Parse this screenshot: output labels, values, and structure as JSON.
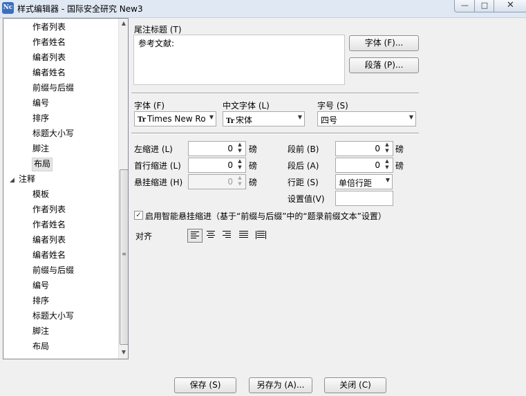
{
  "window": {
    "title": "样式编辑器 - 国际安全研究 New3",
    "icon_text": "Nc",
    "min_glyph": "—",
    "max_glyph": "□",
    "close_glyph": "✕"
  },
  "tree": {
    "group1_items": [
      "作者列表",
      "作者姓名",
      "编者列表",
      "编者姓名",
      "前缀与后缀",
      "编号",
      "排序",
      "标题大小写",
      "脚注",
      "布局"
    ],
    "parent": "注释",
    "group2_items": [
      "模板",
      "作者列表",
      "作者姓名",
      "编者列表",
      "编者姓名",
      "前缀与后缀",
      "编号",
      "排序",
      "标题大小写",
      "脚注",
      "布局"
    ],
    "selected": "布局"
  },
  "footnote": {
    "label": "尾注标题 (T)",
    "value": "参考文献:"
  },
  "buttons": {
    "font": "字体 (F)...",
    "paragraph": "段落 (P)...",
    "save": "保存 (S)",
    "save_as": "另存为 (A)...",
    "close": "关闭 (C)"
  },
  "fonts": {
    "font_label": "字体 (F)",
    "font_value": "Times New Ro",
    "cn_font_label": "中文字体 (L)",
    "cn_font_value": "宋体",
    "size_label": "字号 (S)",
    "size_value": "四号",
    "tt_glyph": "Tr"
  },
  "indent": {
    "left_label": "左缩进 (L)",
    "left_value": "0",
    "first_label": "首行缩进 (L)",
    "first_value": "0",
    "hang_label": "悬挂缩进 (H)",
    "hang_value": "0",
    "unit": "磅"
  },
  "spacing": {
    "before_label": "段前 (B)",
    "before_value": "0",
    "after_label": "段后 (A)",
    "after_value": "0",
    "line_label": "行距 (S)",
    "line_value": "单倍行距",
    "setval_label": "设置值(V)",
    "setval_value": "",
    "unit": "磅"
  },
  "smart_hang": {
    "checked": true,
    "label": "启用智能悬挂缩进（基于“前缀与后缀”中的“题录前缀文本”设置）"
  },
  "align": {
    "label": "对齐",
    "options": [
      "left",
      "center",
      "right",
      "justify",
      "distributed"
    ],
    "selected": "left"
  }
}
